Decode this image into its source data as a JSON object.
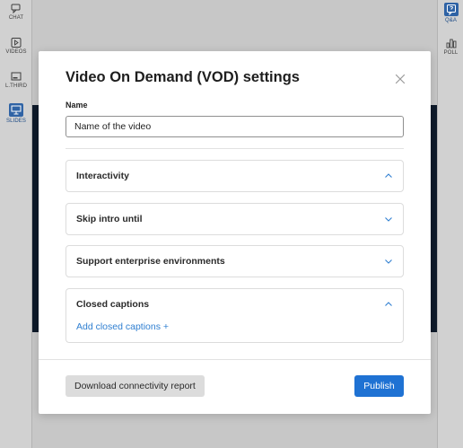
{
  "left_rail": {
    "items": [
      {
        "label": "CHAT",
        "icon": "chat-icon"
      },
      {
        "label": "VIDEOS",
        "icon": "video-icon"
      },
      {
        "label": "L.THIRD",
        "icon": "lower-third-icon"
      },
      {
        "label": "SLIDES",
        "icon": "slides-icon",
        "active": true
      }
    ]
  },
  "right_rail": {
    "items": [
      {
        "label": "Q&A",
        "icon": "qa-icon",
        "active": true
      },
      {
        "label": "POLL",
        "icon": "poll-icon"
      }
    ]
  },
  "modal": {
    "title": "Video On Demand (VOD) settings",
    "name_label": "Name",
    "name_value": "Name of the video",
    "sections": [
      {
        "title": "Interactivity",
        "expanded": true
      },
      {
        "title": "Skip intro until",
        "expanded": false
      },
      {
        "title": "Support enterprise environments",
        "expanded": false
      },
      {
        "title": "Closed captions",
        "expanded": true,
        "action": "Add closed captions +"
      }
    ],
    "download_label": "Download connectivity report",
    "publish_label": "Publish"
  },
  "colors": {
    "accent": "#1f72d3",
    "link": "#2f7fd1",
    "active_rail": "#2f63a5"
  }
}
